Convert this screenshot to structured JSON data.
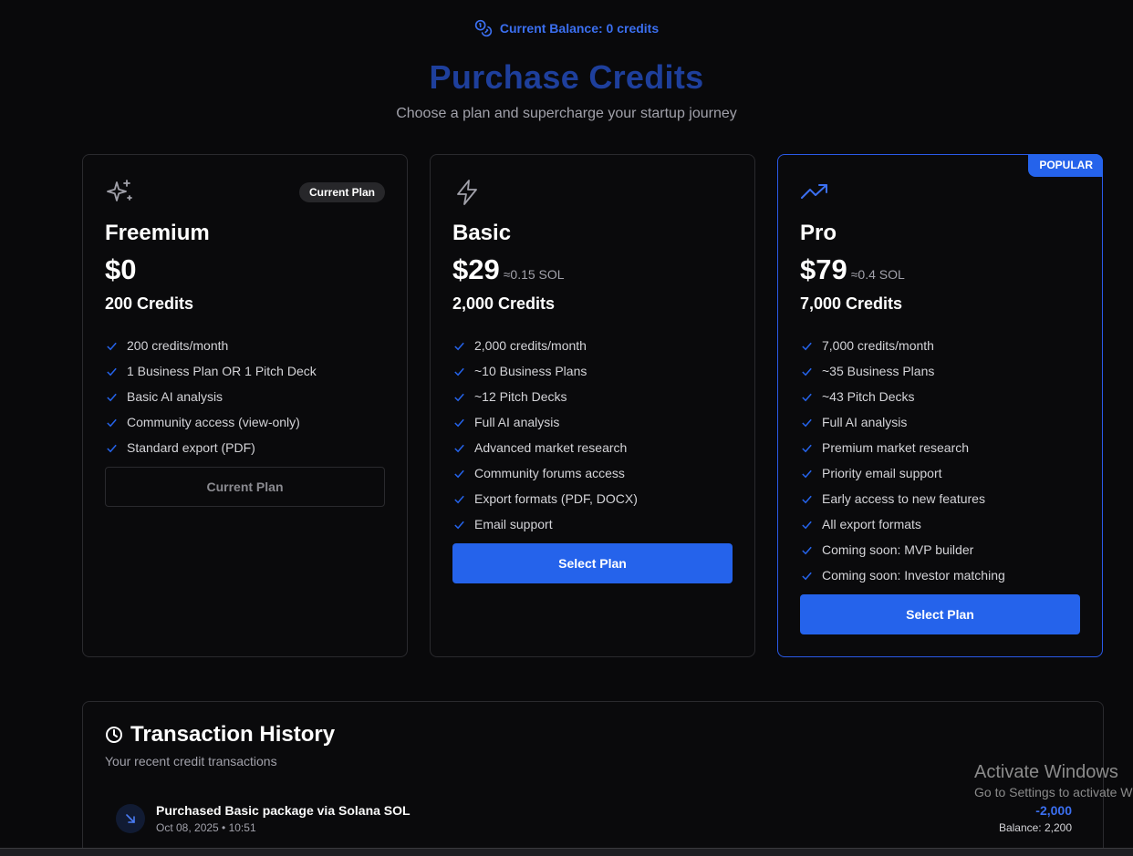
{
  "balance": {
    "text": "Current Balance: 0 credits"
  },
  "header": {
    "title": "Purchase Credits",
    "subtitle": "Choose a plan and supercharge your startup journey"
  },
  "plans": [
    {
      "name": "Freemium",
      "price": "$0",
      "sol": "",
      "credits": "200 Credits",
      "badge": "Current Plan",
      "icon": "sparkles-icon",
      "features": [
        "200 credits/month",
        "1 Business Plan OR 1 Pitch Deck",
        "Basic AI analysis",
        "Community access (view-only)",
        "Standard export (PDF)"
      ],
      "button": "Current Plan"
    },
    {
      "name": "Basic",
      "price": "$29",
      "sol": "≈0.15 SOL",
      "credits": "2,000 Credits",
      "icon": "lightning-icon",
      "features": [
        "2,000 credits/month",
        "~10 Business Plans",
        "~12 Pitch Decks",
        "Full AI analysis",
        "Advanced market research",
        "Community forums access",
        "Export formats (PDF, DOCX)",
        "Email support"
      ],
      "button": "Select Plan"
    },
    {
      "name": "Pro",
      "price": "$79",
      "sol": "≈0.4 SOL",
      "credits": "7,000 Credits",
      "badge": "POPULAR",
      "icon": "trending-up-icon",
      "features": [
        "7,000 credits/month",
        "~35 Business Plans",
        "~43 Pitch Decks",
        "Full AI analysis",
        "Premium market research",
        "Priority email support",
        "Early access to new features",
        "All export formats",
        "Coming soon: MVP builder",
        "Coming soon: Investor matching"
      ],
      "button": "Select Plan"
    }
  ],
  "history": {
    "title": "Transaction History",
    "subtitle": "Your recent credit transactions",
    "transactions": [
      {
        "description": "Purchased Basic package via Solana SOL",
        "date": "Oct 08, 2025 • 10:51",
        "amount": "-2,000",
        "balance": "Balance: 2,200"
      }
    ]
  },
  "watermark": {
    "title": "Activate Windows",
    "subtitle": "Go to Settings to activate Windows."
  },
  "colors": {
    "accent": "#2563eb",
    "title": "#1e3f9c",
    "background": "#09090b"
  }
}
